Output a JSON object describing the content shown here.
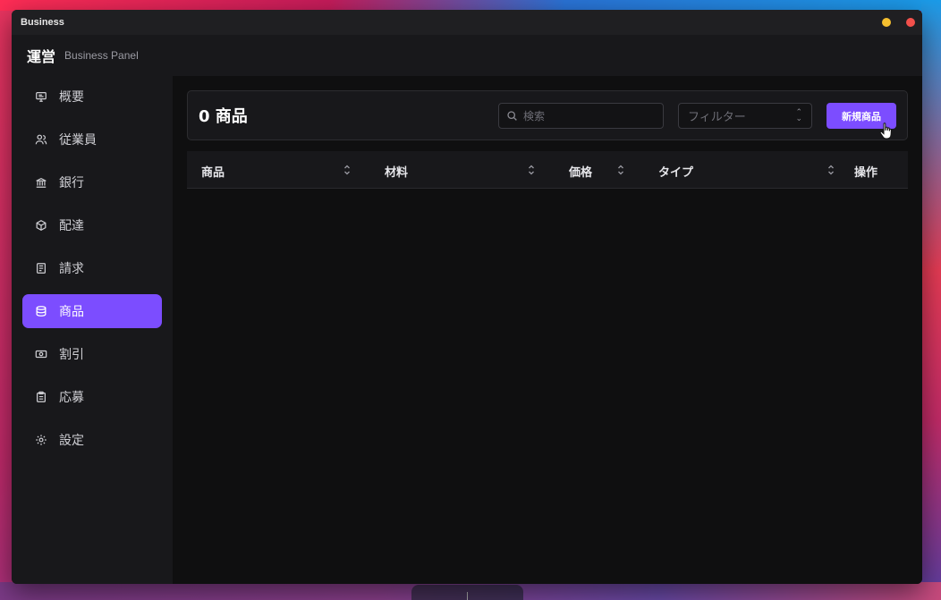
{
  "window": {
    "title": "Business"
  },
  "header": {
    "brand": "運営",
    "subtitle": "Business Panel"
  },
  "sidebar": {
    "items": [
      {
        "label": "概要",
        "icon": "monitor-icon",
        "active": false
      },
      {
        "label": "従業員",
        "icon": "users-icon",
        "active": false
      },
      {
        "label": "銀行",
        "icon": "bank-icon",
        "active": false
      },
      {
        "label": "配達",
        "icon": "package-icon",
        "active": false
      },
      {
        "label": "請求",
        "icon": "receipt-icon",
        "active": false
      },
      {
        "label": "商品",
        "icon": "database-icon",
        "active": true
      },
      {
        "label": "割引",
        "icon": "banknote-icon",
        "active": false
      },
      {
        "label": "応募",
        "icon": "clipboard-icon",
        "active": false
      },
      {
        "label": "設定",
        "icon": "gear-icon",
        "active": false
      }
    ]
  },
  "toolbar": {
    "count_title": "0 商品",
    "search_placeholder": "検索",
    "filter_placeholder": "フィルター",
    "new_button": "新規商品"
  },
  "table": {
    "columns": [
      "商品",
      "材料",
      "価格",
      "タイプ",
      "操作"
    ],
    "rows": []
  },
  "colors": {
    "accent": "#7c4dff",
    "background": "#0f0f10",
    "panel": "#18181b"
  }
}
